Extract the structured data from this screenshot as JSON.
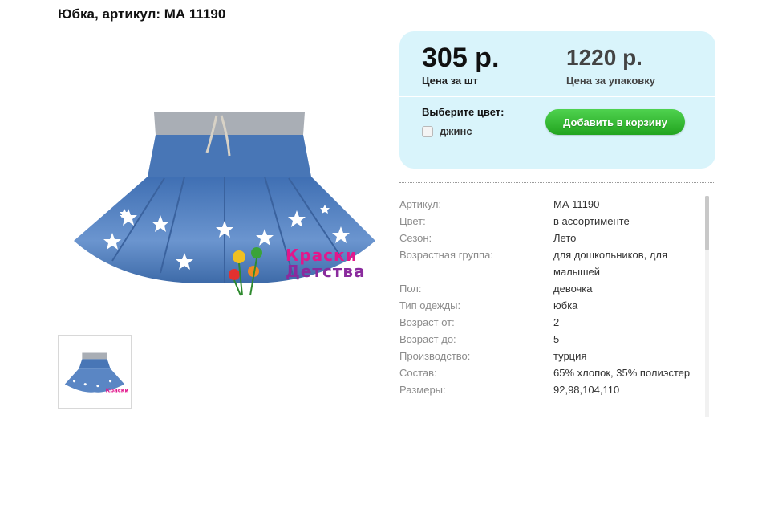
{
  "product": {
    "title": "Юбка, артикул: МА 11190",
    "image_icon": "denim-skirt-image",
    "logo": {
      "line1": "Краски",
      "line2": "Детства"
    }
  },
  "pricing": {
    "unit_price": "305 р.",
    "unit_caption": "Цена за шт",
    "pack_price": "1220 р.",
    "pack_caption": "Цена за упаковку",
    "color_label": "Выберите цвет:",
    "color_option": "джинс",
    "add_to_cart": "Добавить в корзину"
  },
  "specs": [
    {
      "key": "Артикул:",
      "value": "МА 11190"
    },
    {
      "key": "Цвет:",
      "value": "в ассортименте"
    },
    {
      "key": "Сезон:",
      "value": "Лето"
    },
    {
      "key": "Возрастная группа:",
      "value": "для дошкольников, для малышей"
    },
    {
      "key": "Пол:",
      "value": "девочка"
    },
    {
      "key": "Тип одежды:",
      "value": "юбка"
    },
    {
      "key": "Возраст от:",
      "value": "2"
    },
    {
      "key": "Возраст до:",
      "value": "5"
    },
    {
      "key": "Производство:",
      "value": "турция"
    },
    {
      "key": "Состав:",
      "value": "65% хлопок, 35% полиэстер"
    },
    {
      "key": "Размеры:",
      "value": "92,98,104,110"
    }
  ],
  "colors": {
    "price_box_bg": "#d9f4fb",
    "button_green": "#2bb527",
    "denim": "#4a78b8"
  }
}
